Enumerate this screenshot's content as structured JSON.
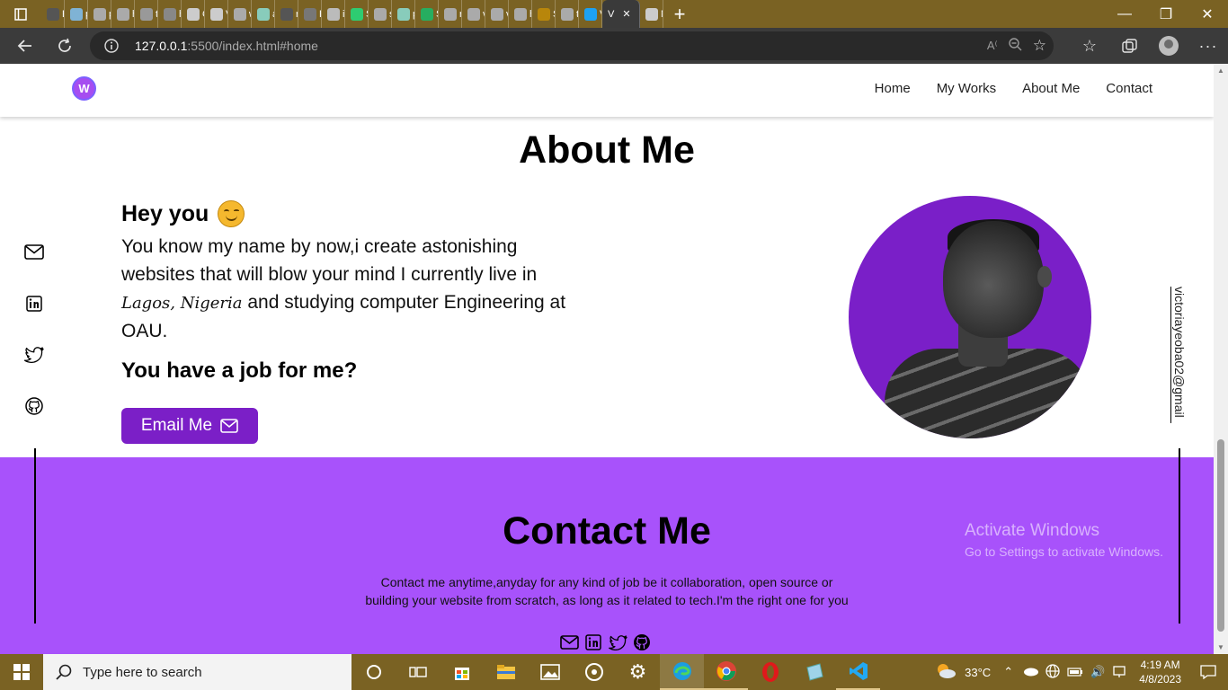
{
  "browser": {
    "tab_letters": [
      "B",
      "p",
      "p",
      "h",
      "t:",
      "h",
      "C",
      "V",
      "w",
      "a",
      "r",
      "H",
      "ic",
      "S",
      "s",
      "p",
      "S",
      "r",
      "v",
      "v",
      "h",
      "S",
      "t:",
      "V",
      "N"
    ],
    "active_tab_letter": "V",
    "url_host": "127.0.0.1",
    "url_path": ":5500/index.html#home"
  },
  "site": {
    "logo_text": "W",
    "nav": [
      "Home",
      "My Works",
      "About Me",
      "Contact"
    ],
    "about_title": "About Me",
    "greeting": "Hey you",
    "about_text_1": "You know my name by now,i create astonishing websites that will blow your mind I currently live in ",
    "about_location": "Lagos, Nigeria",
    "about_text_2": " and studying computer Engineering at OAU.",
    "job_question": "You have a job for me?",
    "email_button": "Email Me",
    "vertical_email": "victoriayeoba02@gmail",
    "contact_title": "Contact Me",
    "contact_text": "Contact me anytime,anyday for any kind of job be it collaboration, open source or building your website from scratch, as long as it related to tech.I'm the right one for you"
  },
  "watermark": {
    "line1": "Activate Windows",
    "line2": "Go to Settings to activate Windows."
  },
  "taskbar": {
    "search_placeholder": "Type here to search",
    "temperature": "33°C",
    "time": "4:19 AM",
    "date": "4/8/2023"
  },
  "colors": {
    "tab_strip": "#7a6223",
    "accent_purple": "#7b1fc7",
    "contact_bg": "#a852fb"
  }
}
